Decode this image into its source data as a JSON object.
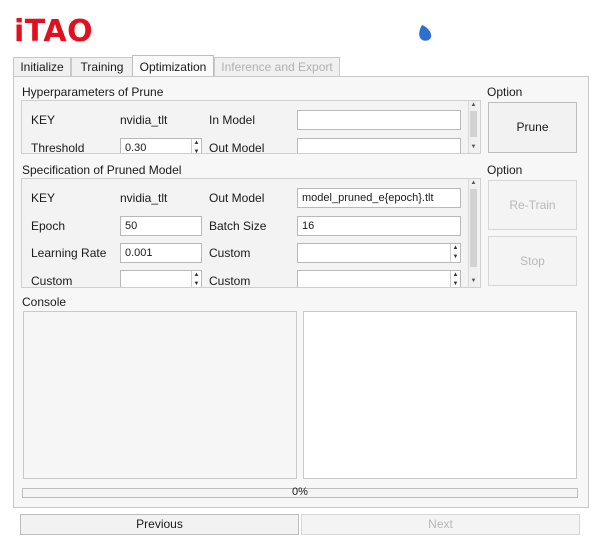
{
  "app": {
    "logo_text": "iTAO",
    "status_icon": "drop-icon",
    "accent_color": "#e0101e"
  },
  "tabs": [
    {
      "label": "Initialize",
      "state": "normal"
    },
    {
      "label": "Training",
      "state": "normal"
    },
    {
      "label": "Optimization",
      "state": "active"
    },
    {
      "label": "Inference and Export",
      "state": "disabled"
    }
  ],
  "prune_section": {
    "title": "Hyperparameters of Prune",
    "key_label": "KEY",
    "key_value": "nvidia_tlt",
    "in_model_label": "In Model",
    "in_model_value": "",
    "threshold_label": "Threshold",
    "threshold_value": "0.30",
    "out_model_label": "Out Model",
    "out_model_value": ""
  },
  "prune_option": {
    "title": "Option",
    "prune_button": "Prune"
  },
  "pruned_section": {
    "title": "Specification of Pruned Model",
    "key_label": "KEY",
    "key_value": "nvidia_tlt",
    "out_model_label": "Out Model",
    "out_model_value": "model_pruned_e{epoch}.tlt",
    "epoch_label": "Epoch",
    "epoch_value": "50",
    "batch_size_label": "Batch Size",
    "batch_size_value": "16",
    "learning_rate_label": "Learning Rate",
    "learning_rate_value": "0.001",
    "custom_label_1": "Custom",
    "custom_value_1": "",
    "custom_label_2": "Custom",
    "custom_value_2": "",
    "custom_label_3": "Custom",
    "custom_value_3": ""
  },
  "retrain_option": {
    "title": "Option",
    "retrain_button": "Re-Train",
    "stop_button": "Stop"
  },
  "console": {
    "title": "Console",
    "left_text": "",
    "right_text": ""
  },
  "progress": {
    "percent": 0,
    "text": "0%"
  },
  "footer": {
    "previous_button": "Previous",
    "next_button": "Next"
  }
}
